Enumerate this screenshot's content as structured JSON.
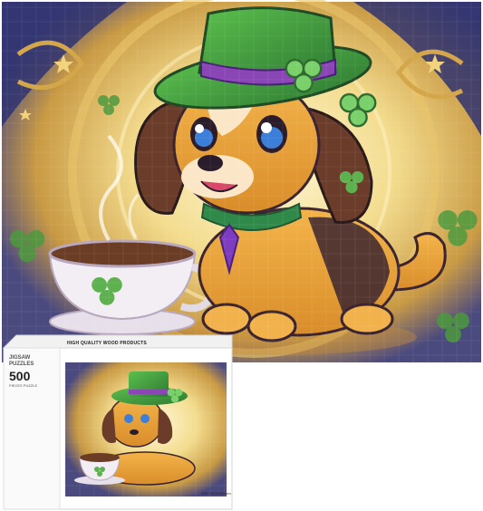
{
  "box": {
    "header": "HIGH QUALITY WOOD PRODUCTS",
    "brand_line1": "JIGSAW",
    "brand_line2": "PUZZLES",
    "piece_count": "500",
    "pieces_label": "PIECES PUZZLE",
    "size_label": "SIZE:520X380mm"
  },
  "colors": {
    "hat": "#3f9a3a",
    "hat_band": "#8a46b5",
    "dog_body": "#e9a23c",
    "dog_dark": "#3b2430",
    "background_glow": "#f6e6a8",
    "cup": "#f2eef4"
  },
  "icons": [
    "shamrock-icon"
  ]
}
